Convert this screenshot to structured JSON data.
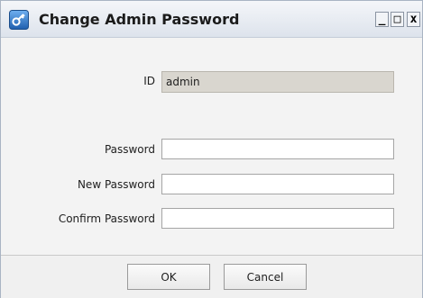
{
  "window": {
    "title": "Change Admin Password",
    "controls": {
      "minimize": "_",
      "maximize": "□",
      "close": "x"
    }
  },
  "form": {
    "id_label": "ID",
    "id_value": "admin",
    "password_label": "Password",
    "password_value": "",
    "new_password_label": "New Password",
    "new_password_value": "",
    "confirm_password_label": "Confirm Password",
    "confirm_password_value": ""
  },
  "buttons": {
    "ok": "OK",
    "cancel": "Cancel"
  },
  "icons": {
    "app": "key-icon"
  },
  "colors": {
    "readonly_field": "#d9d6cf",
    "title_bar": "#e6ebf2"
  }
}
